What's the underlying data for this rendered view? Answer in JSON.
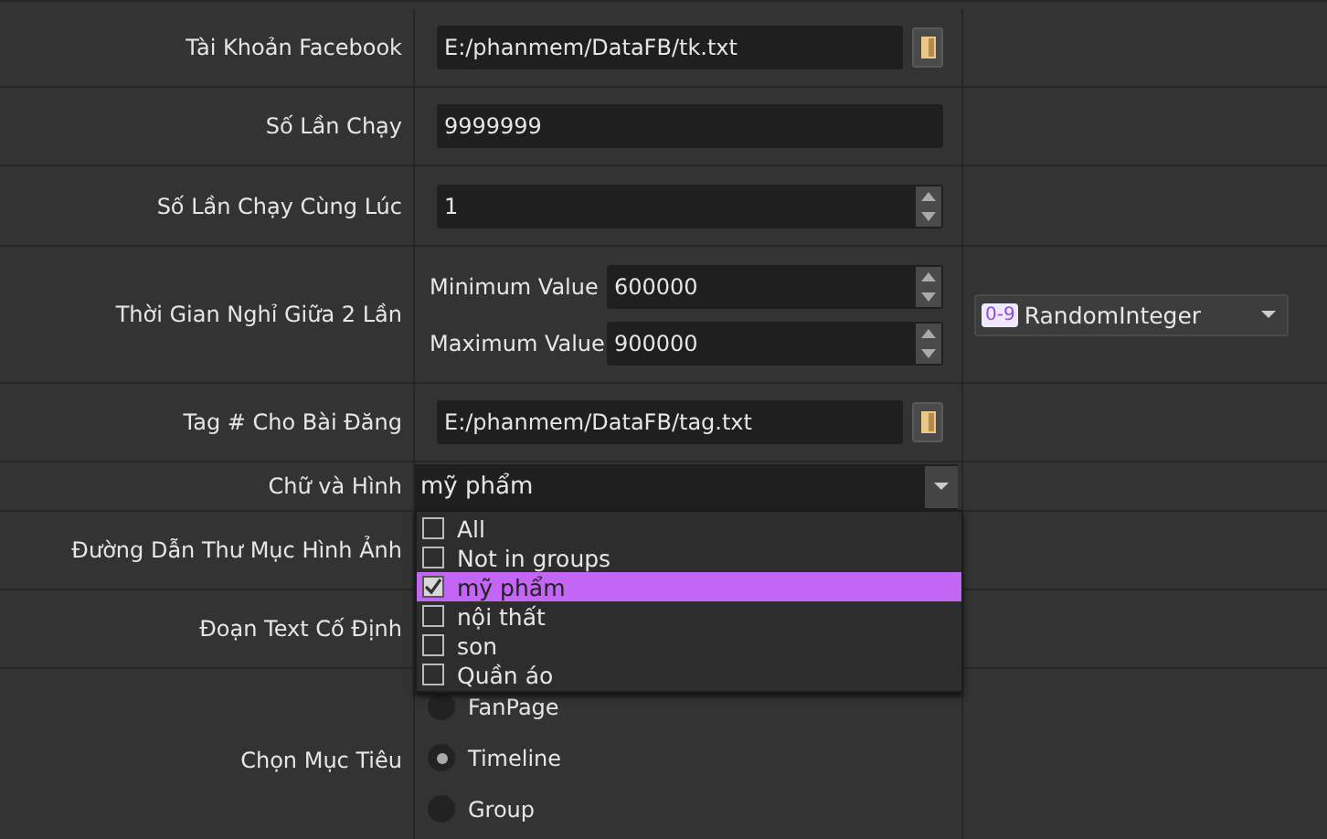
{
  "rows": [
    {
      "label": "Tài Khoản Facebook",
      "kind": "file",
      "value": "E:/phanmem/DataFB/tk.txt"
    },
    {
      "label": "Số Lần Chạy",
      "kind": "text",
      "value": "9999999"
    },
    {
      "label": "Số Lần Chạy Cùng Lúc",
      "kind": "spin",
      "value": "1"
    },
    {
      "label": "Thời Gian Nghỉ Giữa 2 Lần",
      "kind": "range",
      "min_label": "Minimum Value",
      "min_value": "600000",
      "max_label": "Maximum Value",
      "max_value": "900000",
      "mode_badge": "0-9",
      "mode": "RandomInteger"
    },
    {
      "label": "Tag # Cho Bài Đăng",
      "kind": "file",
      "value": "E:/phanmem/DataFB/tag.txt"
    },
    {
      "label": "Chữ và Hình",
      "kind": "combo",
      "value": "mỹ phẩm",
      "expanded": true,
      "options": [
        {
          "text": "All",
          "checked": false,
          "selected": false
        },
        {
          "text": "Not in groups",
          "checked": false,
          "selected": false
        },
        {
          "text": "mỹ phẩm",
          "checked": true,
          "selected": true
        },
        {
          "text": "nội thất",
          "checked": false,
          "selected": false
        },
        {
          "text": "son",
          "checked": false,
          "selected": false
        },
        {
          "text": "Quần áo",
          "checked": false,
          "selected": false
        }
      ]
    },
    {
      "label": "Đường Dẫn Thư Mục Hình Ảnh",
      "kind": "covered"
    },
    {
      "label": "Đoạn Text Cố Định",
      "kind": "covered"
    },
    {
      "label": "Chọn Mục Tiêu",
      "kind": "radio",
      "options": [
        {
          "text": "FanPage",
          "selected": false
        },
        {
          "text": "Timeline",
          "selected": true
        },
        {
          "text": "Group",
          "selected": false
        }
      ]
    }
  ]
}
